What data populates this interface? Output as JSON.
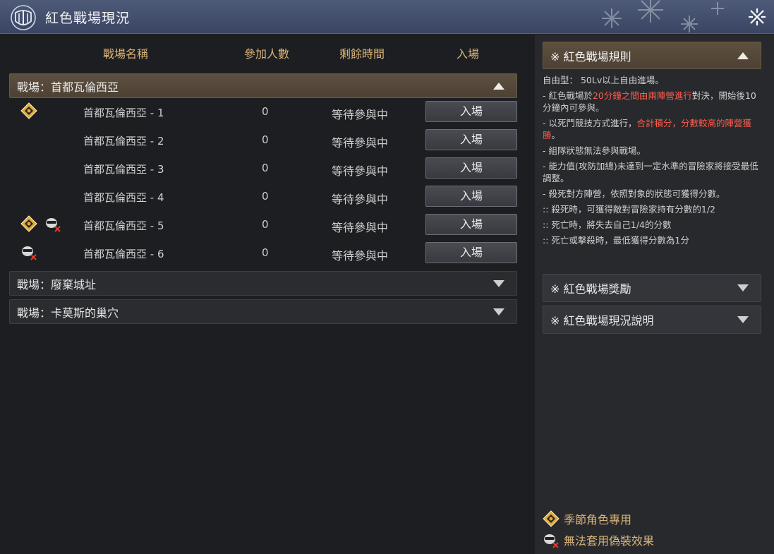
{
  "window": {
    "title": "紅色戰場現況"
  },
  "columns": {
    "name": "戰場名稱",
    "count": "參加人數",
    "time": "剩餘時間",
    "enter": "入場"
  },
  "sections": [
    {
      "label": "戰場：首都瓦倫西亞",
      "expanded": true,
      "rows": [
        {
          "name": "首都瓦倫西亞 - 1",
          "count": "0",
          "status": "等待參與中",
          "button": "入場",
          "icons": [
            "season-icon"
          ]
        },
        {
          "name": "首都瓦倫西亞 - 2",
          "count": "0",
          "status": "等待參與中",
          "button": "入場",
          "icons": []
        },
        {
          "name": "首都瓦倫西亞 - 3",
          "count": "0",
          "status": "等待參與中",
          "button": "入場",
          "icons": []
        },
        {
          "name": "首都瓦倫西亞 - 4",
          "count": "0",
          "status": "等待參與中",
          "button": "入場",
          "icons": []
        },
        {
          "name": "首都瓦倫西亞 - 5",
          "count": "0",
          "status": "等待參與中",
          "button": "入場",
          "icons": [
            "season-icon",
            "no-disguise-icon"
          ]
        },
        {
          "name": "首都瓦倫西亞 - 6",
          "count": "0",
          "status": "等待參與中",
          "button": "入場",
          "icons": [
            "no-disguise-icon"
          ]
        }
      ]
    },
    {
      "label": "戰場：廢棄城址",
      "expanded": false,
      "rows": []
    },
    {
      "label": "戰場：卡莫斯的巢穴",
      "expanded": false,
      "rows": []
    }
  ],
  "rules": {
    "header": "※ 紅色戰場規則",
    "free_entry": "自由型： 50Lv以上自由進場。",
    "line1_a": "- 紅色戰場於",
    "line1_hl": "20分鐘之間由兩陣營進行",
    "line1_b": "對決，開始後10分鐘內可參與。",
    "line2_a": "- 以死鬥競技方式進行，",
    "line2_hl1": "合計積分",
    "line2_mid": "，",
    "line2_hl2": "分數較高的陣營獲勝",
    "line2_b": "。",
    "line3": "- 組隊狀態無法參與戰場。",
    "line4": "- 能力值(攻防加總)未達到一定水準的冒險家將接受最低調整。",
    "line5": "- 殺死對方陣營，依照對象的狀態可獲得分數。",
    "line6": ":: 殺死時，可獲得敵對冒險家持有分數的1/2",
    "line7": ":: 死亡時，將失去自己1/4的分數",
    "line8": ":: 死亡或擊殺時，最低獲得分數為1分"
  },
  "rewards_header": "※ 紅色戰場獎勵",
  "status_header": "※ 紅色戰場現況說明",
  "legend": {
    "season": "季節角色專用",
    "no_disguise": "無法套用偽裝效果"
  },
  "colors": {
    "accent_gold": "#d9b47a",
    "highlight_red": "#ff5b4d",
    "title_bar": "#3a4563"
  }
}
